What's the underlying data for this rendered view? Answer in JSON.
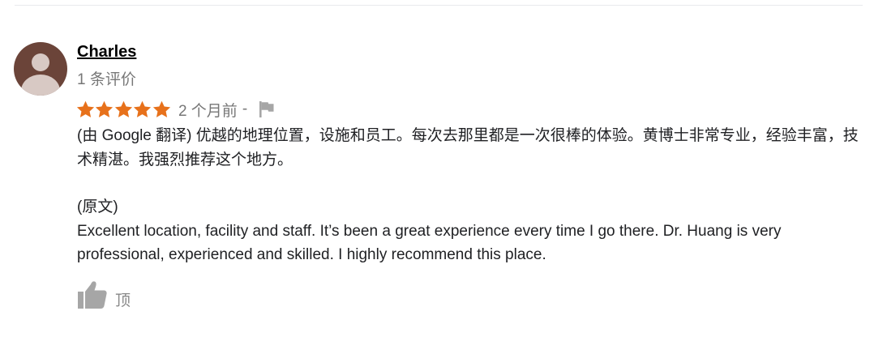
{
  "review": {
    "reviewer_name": "Charles",
    "review_count": "1 条评价",
    "rating": 5,
    "max_rating": 5,
    "relative_time": "2 个月前",
    "separator": "-",
    "translated_text": "(由 Google 翻译) 优越的地理位置，设施和员工。每次去那里都是一次很棒的体验。黄博士非常专业，经验丰富，技术精湛。我强烈推荐这个地方。",
    "original_label": "(原文)",
    "original_text": "Excellent location, facility and staff. It’s been a great experience every time I go there. Dr. Huang is very professional, experienced and skilled. I highly recommend this place.",
    "like_label": "顶"
  },
  "colors": {
    "star": "#e7711b",
    "avatar_bg": "#6b4439",
    "avatar_fg": "#d8c9c4",
    "muted_text": "#777777",
    "icon_gray": "#a6a6a6"
  },
  "icons": {
    "avatar": "person-silhouette",
    "star": "star-filled",
    "flag": "flag-icon",
    "like": "thumbs-up-icon"
  }
}
